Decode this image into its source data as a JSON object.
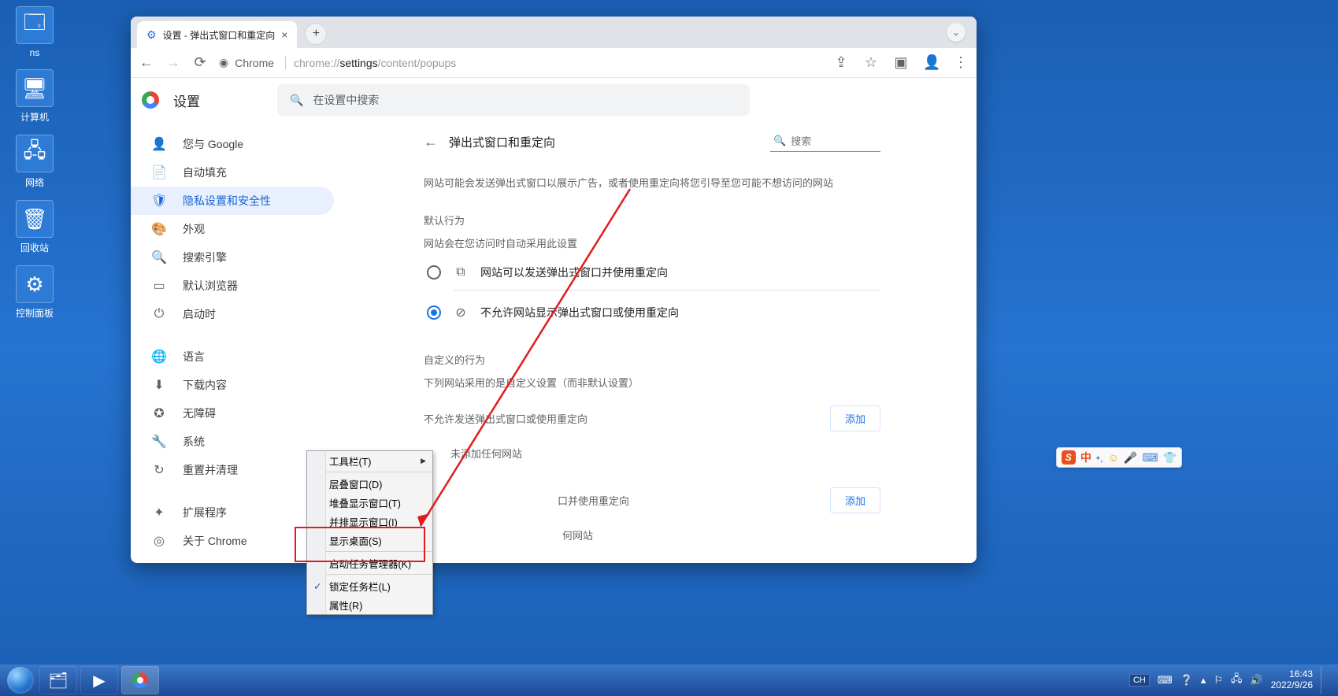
{
  "desktop_icons": [
    "ns",
    "计算机",
    "网络",
    "回收站",
    "控制面板"
  ],
  "window": {
    "tab_title": "设置 - 弹出式窗口和重定向",
    "url_label": "Chrome",
    "url_prefix": "chrome://",
    "url_black": "settings",
    "url_suffix": "/content/popups"
  },
  "settings": {
    "title": "设置",
    "search_placeholder": "在设置中搜索"
  },
  "sidebar": {
    "items": [
      {
        "label": "您与 Google",
        "icon": "👤"
      },
      {
        "label": "自动填充",
        "icon": "📄"
      },
      {
        "label": "隐私设置和安全性",
        "icon": "🛡"
      },
      {
        "label": "外观",
        "icon": "🎨"
      },
      {
        "label": "搜索引擎",
        "icon": "🔍"
      },
      {
        "label": "默认浏览器",
        "icon": "▭"
      },
      {
        "label": "启动时",
        "icon": "⏻"
      }
    ],
    "items2": [
      {
        "label": "语言",
        "icon": "🌐"
      },
      {
        "label": "下载内容",
        "icon": "⬇"
      },
      {
        "label": "无障碍",
        "icon": "✪"
      },
      {
        "label": "系统",
        "icon": "🔧"
      },
      {
        "label": "重置并清理",
        "icon": "↻"
      }
    ],
    "items3": [
      {
        "label": "扩展程序",
        "icon": "✦",
        "ext": true
      },
      {
        "label": "关于 Chrome",
        "icon": "◎"
      }
    ]
  },
  "content": {
    "page_title": "弹出式窗口和重定向",
    "search_label": "搜索",
    "desc": "网站可能会发送弹出式窗口以展示广告，或者使用重定向将您引导至您可能不想访问的网站",
    "default_title": "默认行为",
    "default_sub": "网站会在您访问时自动采用此设置",
    "radio_allow": "网站可以发送弹出式窗口并使用重定向",
    "radio_block": "不允许网站显示弹出式窗口或使用重定向",
    "custom_title": "自定义的行为",
    "custom_sub": "下列网站采用的是自定义设置（而非默认设置）",
    "block_section": "不允许发送弹出式窗口或使用重定向",
    "allow_section_tail": "口并使用重定向",
    "none_text": "未添加任何网站",
    "none_text2": "何网站",
    "add_btn": "添加"
  },
  "context_menu": {
    "items": [
      {
        "label": "工具栏(T)",
        "arrow": true
      },
      {
        "label": "层叠窗口(D)"
      },
      {
        "label": "堆叠显示窗口(T)"
      },
      {
        "label": "并排显示窗口(I)"
      },
      {
        "label": "显示桌面(S)"
      },
      {
        "label": "启动任务管理器(K)"
      },
      {
        "label": "锁定任务栏(L)",
        "check": true
      },
      {
        "label": "属性(R)"
      }
    ]
  },
  "taskbar": {
    "lang": "CH",
    "time": "16:43",
    "date": "2022/9/26"
  },
  "ime": {
    "cn": "中"
  }
}
